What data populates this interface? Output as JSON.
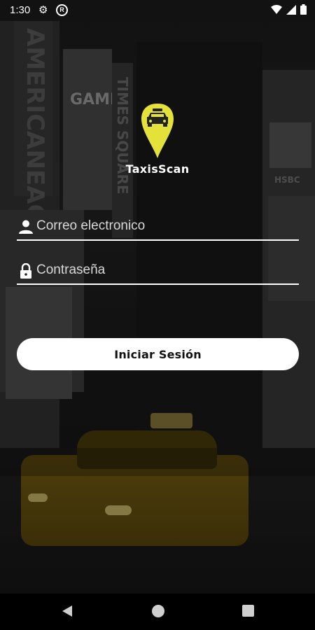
{
  "status_bar": {
    "time": "1:30"
  },
  "brand": {
    "name": "TaxisScan",
    "accent": "#e4e13a"
  },
  "login": {
    "email_placeholder": "Correo electronico",
    "password_placeholder": "Contraseña",
    "submit_label": "Iniciar Sesión"
  },
  "background_signs": {
    "sign1": "AMERICANEAGLEOUT",
    "sign2": "GAME",
    "sign3": "TIMES SQUARE",
    "sign4": "HSBC"
  },
  "colors": {
    "underline": "#ffffff",
    "button_bg": "#ffffff",
    "button_text": "#111111"
  }
}
